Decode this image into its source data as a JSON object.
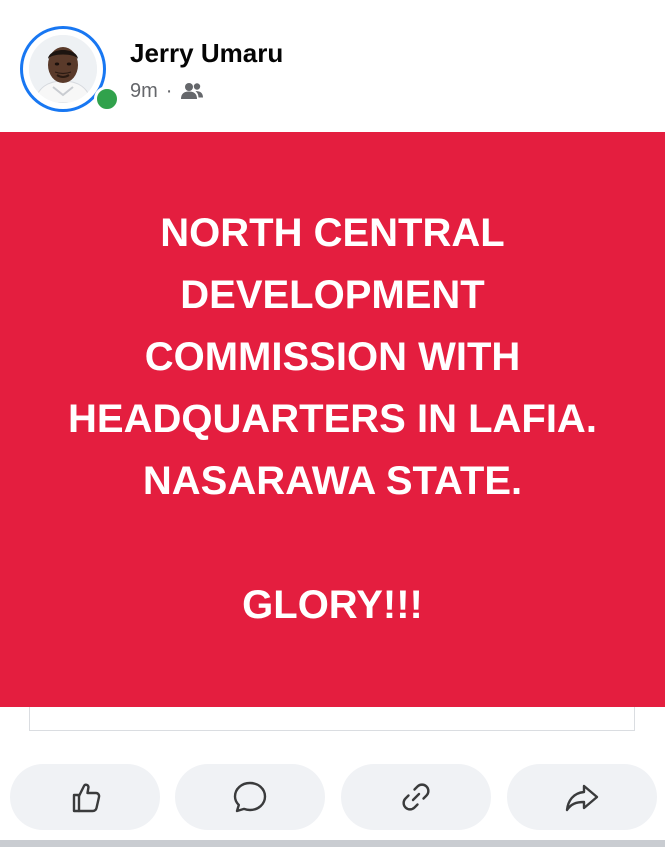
{
  "post": {
    "author": "Jerry Umaru",
    "time": "9m",
    "separator": "·",
    "audience_icon": "friends-icon",
    "banner_color": "#e41e3f",
    "text": "NORTH CENTRAL\nDEVELOPMENT\nCOMMISSION WITH\nHEADQUARTERS IN LAFIA.\nNASARAWA STATE.\n\nGLORY!!!"
  },
  "actions": [
    {
      "icon": "like-icon"
    },
    {
      "icon": "comment-icon"
    },
    {
      "icon": "copy-link-icon"
    },
    {
      "icon": "share-icon"
    }
  ],
  "colors": {
    "accent": "#1877f2",
    "online": "#31a24c",
    "button_bg": "#f0f2f5"
  }
}
